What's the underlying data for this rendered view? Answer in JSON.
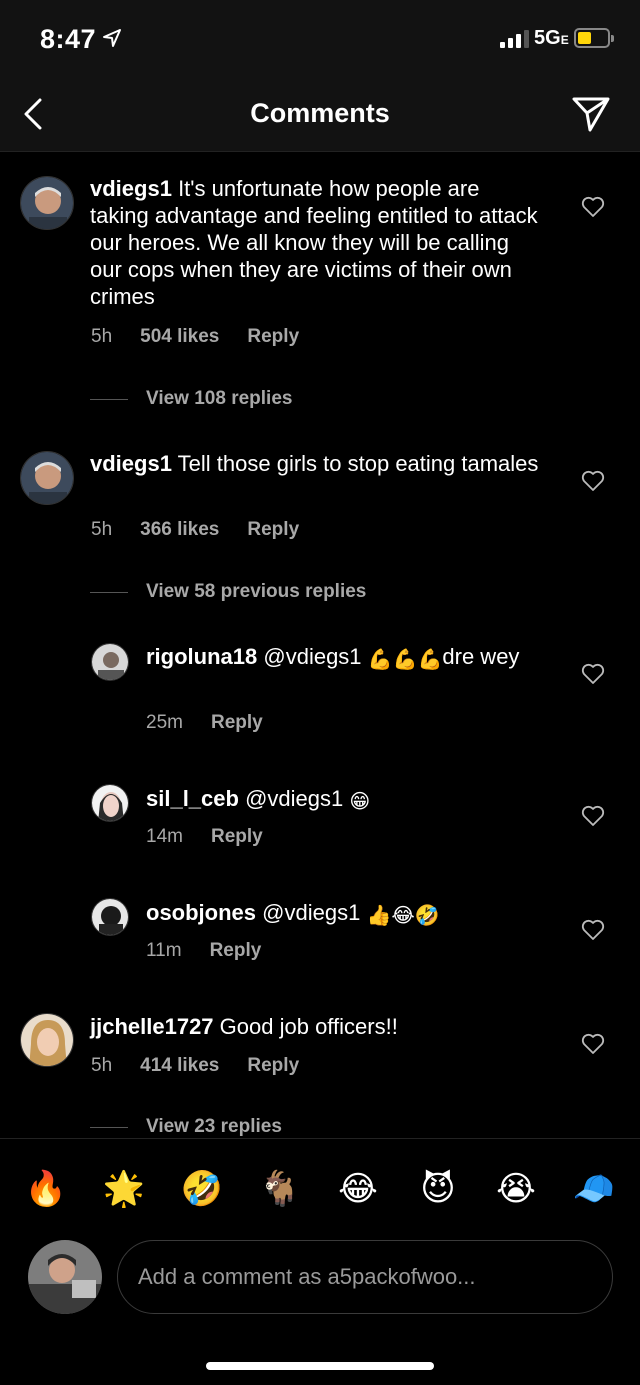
{
  "status_bar": {
    "time": "8:47",
    "network": "5G",
    "battery_level": 0.45,
    "location_icon": "location-arrow-icon",
    "signal_icon": "signal-bars-icon"
  },
  "header": {
    "title": "Comments",
    "back_icon": "chevron-left-icon",
    "share_icon": "paper-plane-icon"
  },
  "comments": [
    {
      "username": "vdiegs1",
      "text": "It's unfortunate how people are taking advantage and feeling entitled to attack our heroes. We all know they will be calling our cops when they are victims of their own crimes",
      "time": "5h",
      "likes": "504 likes",
      "reply": "Reply",
      "view_replies": "View 108 replies"
    },
    {
      "username": "vdiegs1",
      "text": "Tell those girls to stop eating tamales",
      "time": "5h",
      "likes": "366 likes",
      "reply": "Reply",
      "view_replies": "View 58 previous replies",
      "replies": [
        {
          "username": "rigoluna18",
          "text_before": "@vdiegs1",
          "emojis": "💪💪💪",
          "text_after": "dre wey",
          "time": "25m",
          "reply": "Reply"
        },
        {
          "username": "sil_l_ceb",
          "text_before": "@vdiegs1",
          "emojis": "😁",
          "text_after": "",
          "time": "14m",
          "reply": "Reply"
        },
        {
          "username": "osobjones",
          "text_before": "@vdiegs1",
          "emojis": "👍😂🤣",
          "text_after": "",
          "time": "11m",
          "reply": "Reply"
        }
      ]
    },
    {
      "username": "jjchelle1727",
      "text": "Good job officers!!",
      "time": "5h",
      "likes": "414 likes",
      "reply": "Reply",
      "view_replies": "View 23 replies"
    }
  ],
  "emoji_bar": [
    "🔥",
    "🌟",
    "🤣",
    "🐐",
    "😂",
    "😈",
    "😭",
    "🧢"
  ],
  "compose": {
    "placeholder": "Add a comment as a5packofwoo..."
  },
  "colors": {
    "background": "#000000",
    "header_bg": "#121212",
    "secondary_text": "#a8a8a8",
    "battery": "#ffd60a"
  }
}
